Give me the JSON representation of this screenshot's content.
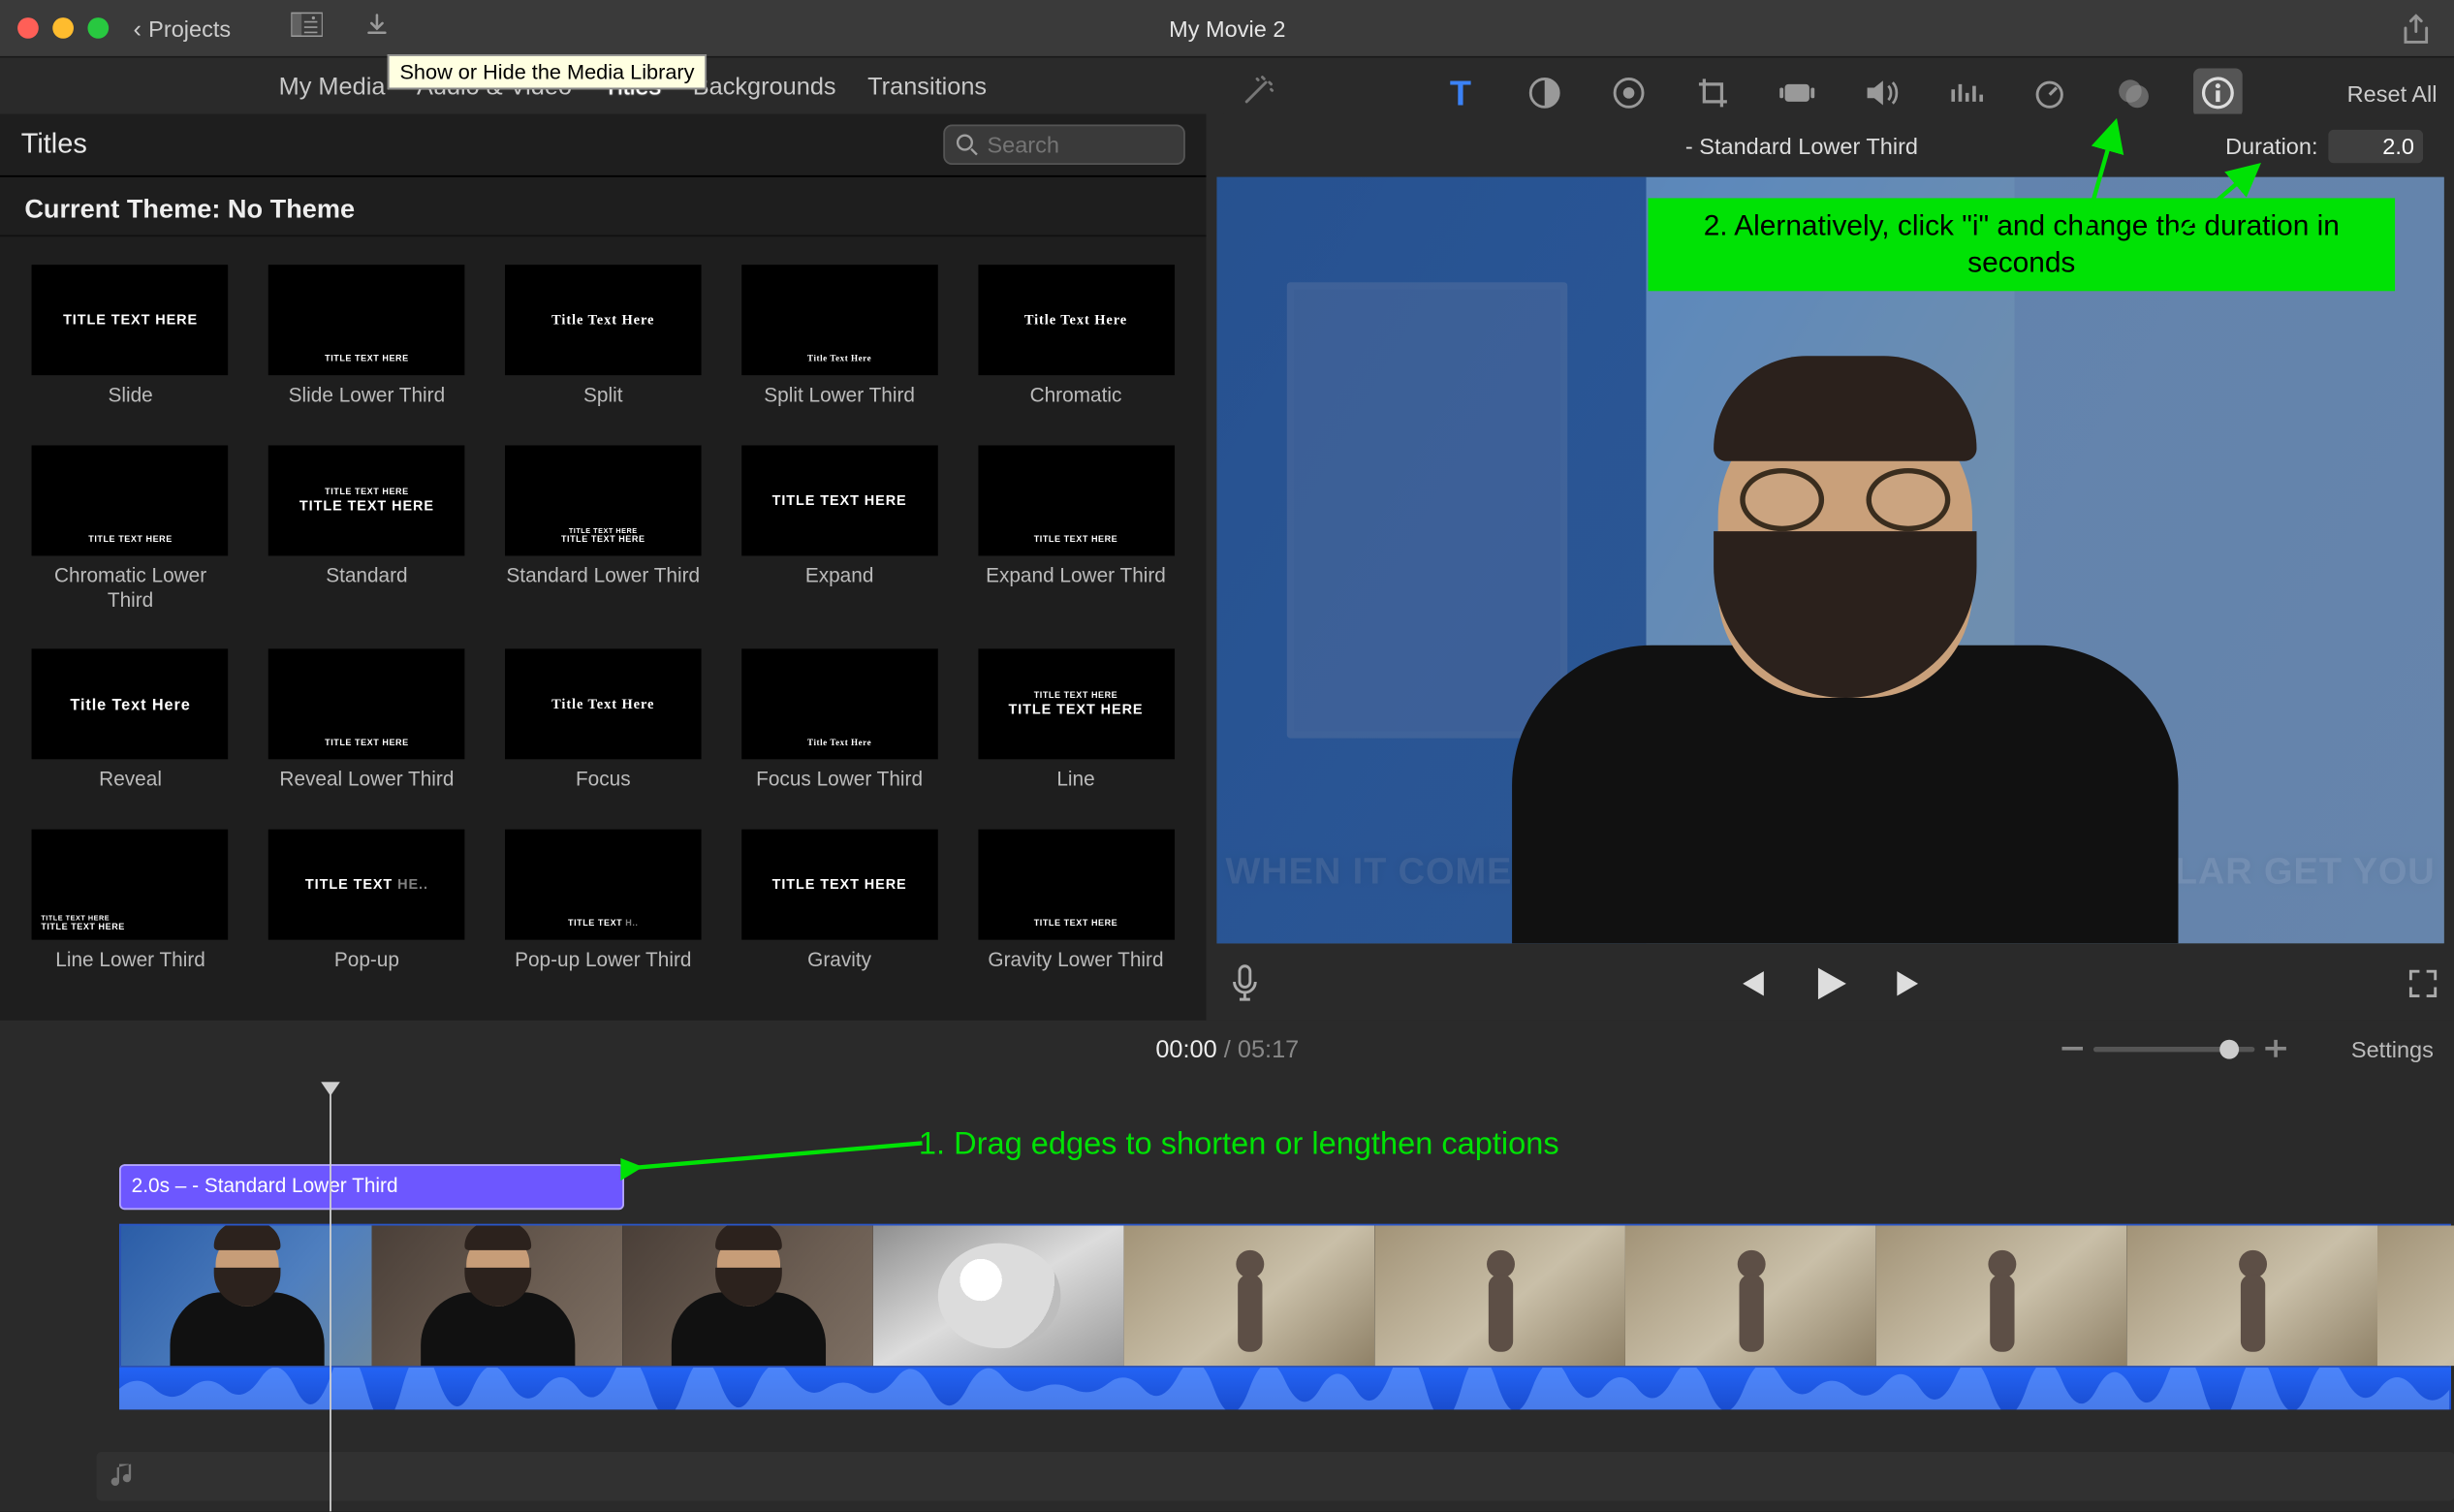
{
  "titlebar": {
    "back_label": "Projects",
    "project_title": "My Movie 2",
    "media_tooltip": "Show or Hide the Media Library"
  },
  "tabs": {
    "my_media": "My Media",
    "audio_video": "Audio & Video",
    "titles": "Titles",
    "backgrounds": "Backgrounds",
    "transitions": "Transitions",
    "active": "Titles"
  },
  "right_toolbar": {
    "reset": "Reset All",
    "icons": [
      "text-icon",
      "color-balance-icon",
      "color-wheel-icon",
      "crop-icon",
      "stabilize-icon",
      "volume-icon",
      "eq-icon",
      "speed-icon",
      "effects-icon",
      "info-icon"
    ],
    "selected": "info-icon"
  },
  "browser": {
    "section_title": "Titles",
    "search_placeholder": "Search",
    "theme_prefix": "Current Theme: ",
    "theme_value": "No Theme",
    "items": [
      {
        "label": "Slide",
        "style": "center"
      },
      {
        "label": "Slide Lower Third",
        "style": "lower"
      },
      {
        "label": "Split",
        "style": "center-serif"
      },
      {
        "label": "Split Lower Third",
        "style": "lower-serif"
      },
      {
        "label": "Chromatic",
        "style": "center-serif"
      },
      {
        "label": "Chromatic Lower Third",
        "style": "lower"
      },
      {
        "label": "Standard",
        "style": "center-stack"
      },
      {
        "label": "Standard Lower Third",
        "style": "lower-stack"
      },
      {
        "label": "Expand",
        "style": "center"
      },
      {
        "label": "Expand Lower Third",
        "style": "lower"
      },
      {
        "label": "Reveal",
        "style": "center-bold"
      },
      {
        "label": "Reveal Lower Third",
        "style": "lower"
      },
      {
        "label": "Focus",
        "style": "center-serif"
      },
      {
        "label": "Focus Lower Third",
        "style": "lower-serif"
      },
      {
        "label": "Line",
        "style": "center-stack"
      },
      {
        "label": "Line Lower Third",
        "style": "lower-stack-left"
      },
      {
        "label": "Pop-up",
        "style": "center-pop"
      },
      {
        "label": "Pop-up Lower Third",
        "style": "lower-pop"
      },
      {
        "label": "Gravity",
        "style": "center"
      },
      {
        "label": "Gravity Lower Third",
        "style": "lower"
      }
    ],
    "thumb_text_primary": "TITLE TEXT HERE",
    "thumb_text_secondary": "Title Text Here"
  },
  "info_panel": {
    "clip_name": "- Standard Lower Third",
    "duration_label": "Duration:",
    "duration_value": "2.0"
  },
  "viewer": {
    "caption_text": "WHEN IT COMES TO LIGHTING, WHAT DOES A DOLLAR GET  YOU"
  },
  "timecode": {
    "current": "00:00",
    "total": "05:17",
    "separator": " / ",
    "settings_label": "Settings"
  },
  "timeline": {
    "title_clip_label": "2.0s –   - Standard Lower Third"
  },
  "annotations": {
    "step1": "1. Drag edges to shorten or lengthen captions",
    "step2": "2. Alernatively, click \"i\" and change the duration in seconds"
  },
  "colors": {
    "accent_purple": "#6d57ff",
    "annotation_green": "#00e205",
    "audio_blue": "#1f5ae6"
  }
}
